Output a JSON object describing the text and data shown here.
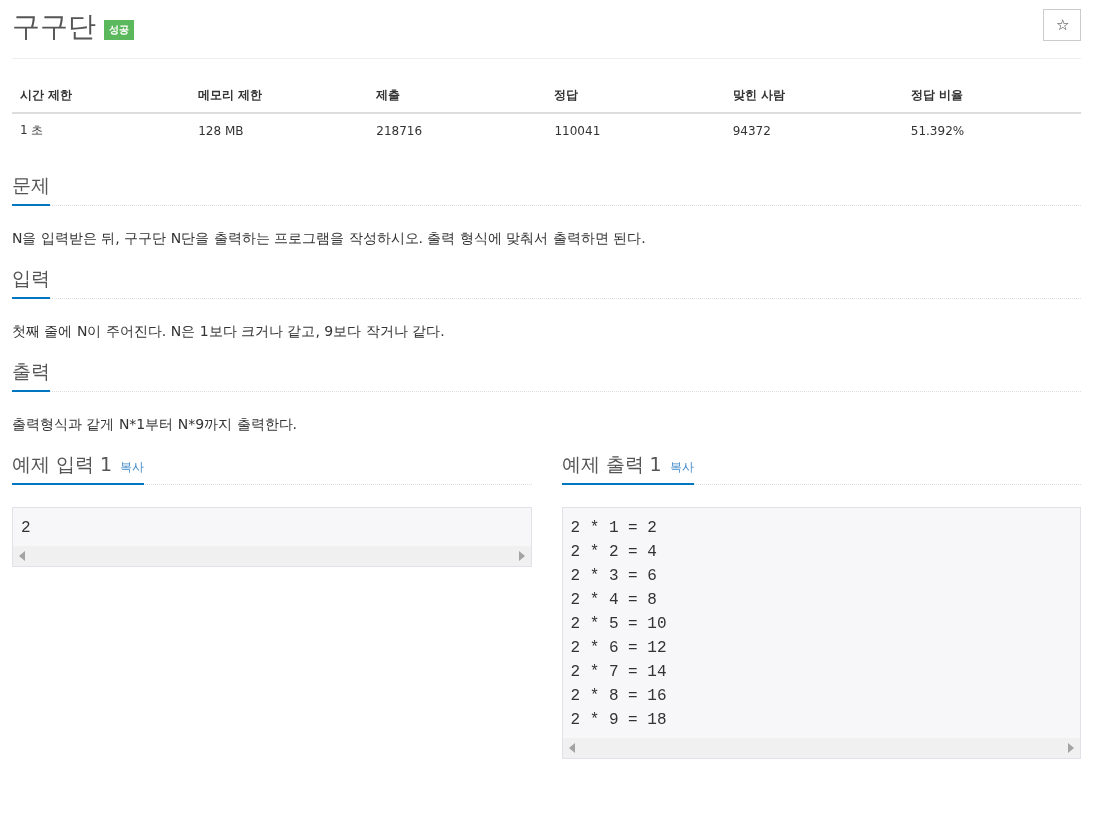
{
  "title": "구구단",
  "badge": "성공",
  "star_button": {
    "label": "☆"
  },
  "info_table": {
    "columns": [
      "시간 제한",
      "메모리 제한",
      "제출",
      "정답",
      "맞힌 사람",
      "정답 비율"
    ],
    "rows": [
      [
        "1 초",
        "128 MB",
        "218716",
        "110041",
        "94372",
        "51.392%"
      ]
    ]
  },
  "sections": [
    {
      "heading": "문제",
      "text": "N을 입력받은 뒤, 구구단 N단을 출력하는 프로그램을 작성하시오. 출력 형식에 맞춰서 출력하면 된다."
    },
    {
      "heading": "입력",
      "text": "첫째 줄에 N이 주어진다. N은 1보다 크거나 같고, 9보다 작거나 같다."
    },
    {
      "heading": "출력",
      "text": "출력형식과 같게 N*1부터 N*9까지 출력한다."
    }
  ],
  "samples": [
    {
      "heading": "예제 입력 1",
      "copy": "복사",
      "lines": [
        "2"
      ]
    },
    {
      "heading": "예제 출력 1",
      "copy": "복사",
      "lines": [
        "2 * 1 = 2",
        "2 * 2 = 4",
        "2 * 3 = 6",
        "2 * 4 = 8",
        "2 * 5 = 10",
        "2 * 6 = 12",
        "2 * 7 = 14",
        "2 * 8 = 16",
        "2 * 9 = 18"
      ]
    }
  ]
}
